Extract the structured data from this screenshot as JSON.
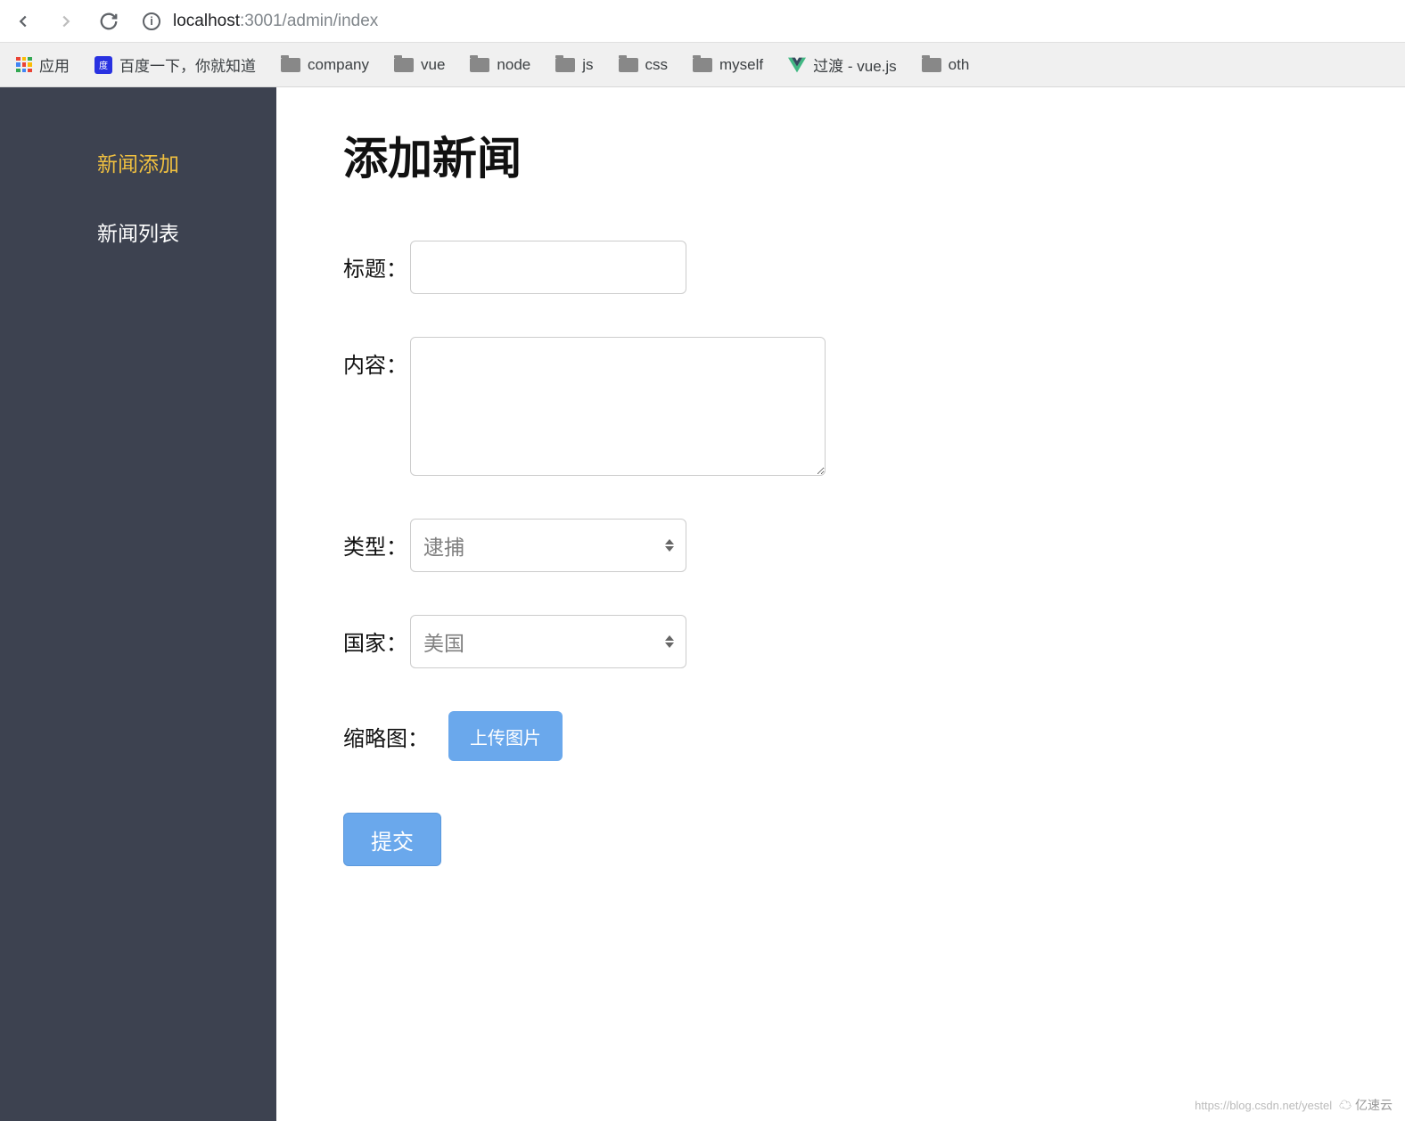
{
  "browser": {
    "url_host": "localhost",
    "url_rest": ":3001/admin/index"
  },
  "bookmarks": {
    "apps": "应用",
    "baidu": "百度一下，你就知道",
    "company": "company",
    "vue": "vue",
    "node": "node",
    "js": "js",
    "css": "css",
    "myself": "myself",
    "vuejs": "过渡 - vue.js",
    "other": "oth"
  },
  "sidebar": {
    "add": "新闻添加",
    "list": "新闻列表"
  },
  "page": {
    "title": "添加新闻"
  },
  "form": {
    "title_label": "标题：",
    "content_label": "内容：",
    "type_label": "类型：",
    "type_value": "逮捕",
    "country_label": "国家：",
    "country_value": "美国",
    "thumb_label": "缩略图：",
    "upload_btn": "上传图片",
    "submit_btn": "提交"
  },
  "watermark": {
    "url": "https://blog.csdn.net/yestel",
    "brand": "亿速云"
  }
}
